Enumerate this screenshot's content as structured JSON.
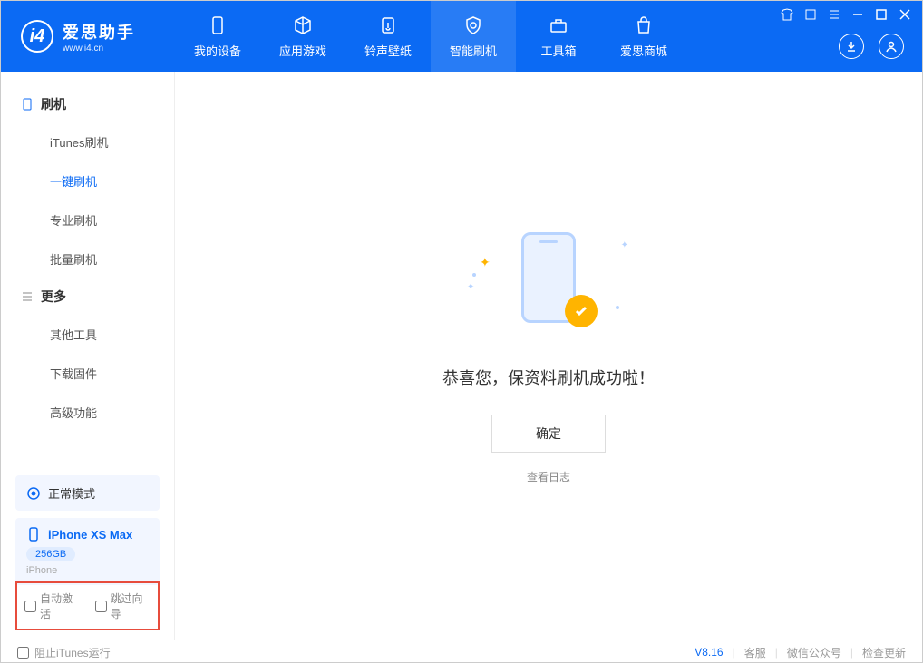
{
  "app": {
    "name_cn": "爱思助手",
    "name_en": "www.i4.cn"
  },
  "tabs": [
    {
      "label": "我的设备"
    },
    {
      "label": "应用游戏"
    },
    {
      "label": "铃声壁纸"
    },
    {
      "label": "智能刷机"
    },
    {
      "label": "工具箱"
    },
    {
      "label": "爱思商城"
    }
  ],
  "sidebar": {
    "section1_title": "刷机",
    "items1": [
      {
        "label": "iTunes刷机"
      },
      {
        "label": "一键刷机"
      },
      {
        "label": "专业刷机"
      },
      {
        "label": "批量刷机"
      }
    ],
    "section2_title": "更多",
    "items2": [
      {
        "label": "其他工具"
      },
      {
        "label": "下载固件"
      },
      {
        "label": "高级功能"
      }
    ]
  },
  "mode": {
    "label": "正常模式"
  },
  "device": {
    "name": "iPhone XS Max",
    "storage": "256GB",
    "type": "iPhone"
  },
  "checkboxes": {
    "auto_activate": "自动激活",
    "skip_guide": "跳过向导"
  },
  "main": {
    "success_msg": "恭喜您，保资料刷机成功啦！",
    "ok_button": "确定",
    "view_log": "查看日志"
  },
  "footer": {
    "prevent_itunes": "阻止iTunes运行",
    "version": "V8.16",
    "support": "客服",
    "wechat": "微信公众号",
    "check_update": "检查更新"
  }
}
